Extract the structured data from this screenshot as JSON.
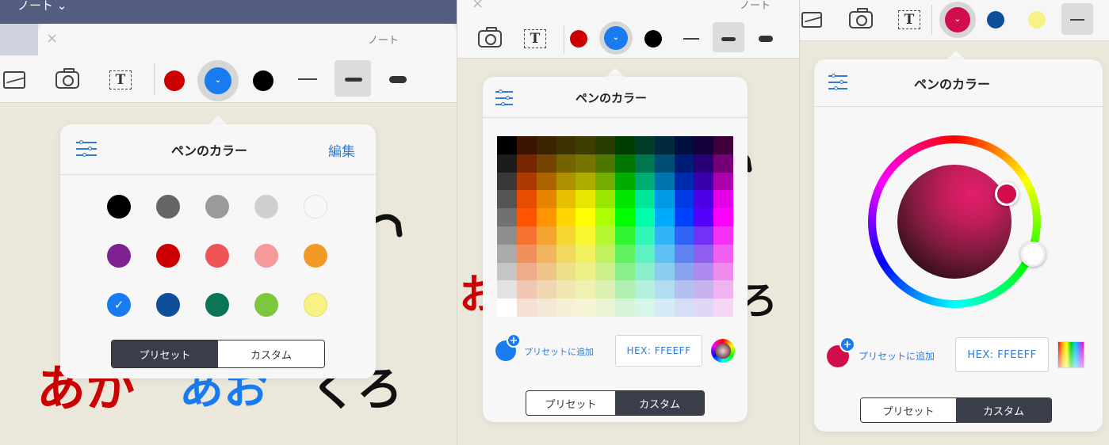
{
  "app": {
    "nav_title": "ノート ⌄",
    "window_title": "ノート",
    "close_icon": "×"
  },
  "colors": {
    "accent_blue": "#1a7bf0",
    "link_blue": "#2f7bd6",
    "red": "#cc0000",
    "black": "#000000",
    "segment_active": "#3a3d4a"
  },
  "toolbar": {
    "items": [
      "image-icon",
      "camera-icon",
      "text-box-icon",
      "red-pen",
      "blue-pen-selected",
      "black-pen",
      "line-thin",
      "line-medium",
      "line-thick"
    ]
  },
  "popover": {
    "title": "ペンのカラー",
    "edit_label": "編集",
    "settings_icon": "sliders-icon"
  },
  "presets": {
    "rows": [
      [
        "#000000",
        "#666666",
        "#9a9a9a",
        "#cfcfcf",
        "#f8f8f8"
      ],
      [
        "#7d2290",
        "#cc0000",
        "#ef5557",
        "#f59999",
        "#f29a26"
      ],
      [
        "#1a7bf0",
        "#0f4f9a",
        "#0b7656",
        "#7dc63d",
        "#f8f284"
      ]
    ],
    "selected": "#1a7bf0"
  },
  "segments": {
    "preset_label": "プリセット",
    "custom_label": "カスタム"
  },
  "custom": {
    "add_preset_label": "プリセットに追加",
    "hex_label": "HEX:  FFEEFF",
    "plus": "+"
  },
  "handwriting": {
    "aka": "あか",
    "ao": "あお",
    "kuro": "くろ",
    "o_partial": "お",
    "ro_partial": "ろ"
  }
}
